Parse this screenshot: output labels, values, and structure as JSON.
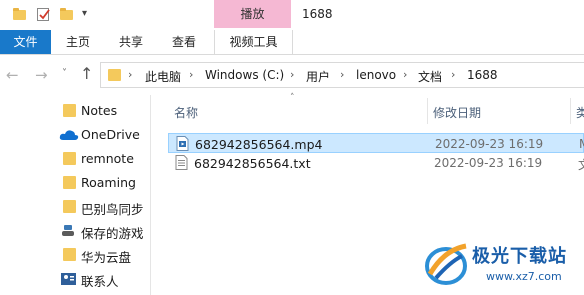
{
  "titlebar": {
    "context_tab": "播放",
    "window_title": "1688"
  },
  "ribbon": {
    "tabs": [
      "文件",
      "主页",
      "共享",
      "查看",
      "视频工具"
    ]
  },
  "breadcrumb": [
    "此电脑",
    "Windows (C:)",
    "用户",
    "lenovo",
    "文档",
    "1688"
  ],
  "nav_pane": {
    "items": [
      "Notes",
      "OneDrive",
      "remnote",
      "Roaming",
      "巴别鸟同步",
      "保存的游戏",
      "华为云盘",
      "联系人"
    ]
  },
  "columns": {
    "name": "名称",
    "modified": "修改日期",
    "type": "类"
  },
  "files": [
    {
      "name": "682942856564.mp4",
      "date": "2022-09-23 16:19",
      "type": "M"
    },
    {
      "name": "682942856564.txt",
      "date": "2022-09-23 16:19",
      "type": "文"
    }
  ],
  "watermark": {
    "brand": "极光下载站",
    "url": "www.xz7.com"
  },
  "colors": {
    "accent": "#1979ca",
    "context_tab": "#f5b8d3",
    "selection": "#cce8ff",
    "folder": "#f4c95c"
  },
  "icons": [
    "folder-icon",
    "checkbox-icon",
    "dropdown-arrow-icon",
    "back-arrow-icon",
    "forward-arrow-icon",
    "recent-chevron-icon",
    "up-arrow-icon",
    "onedrive-cloud-icon",
    "saved-games-icon",
    "contacts-icon",
    "video-file-icon",
    "text-file-icon",
    "sort-up-icon"
  ]
}
